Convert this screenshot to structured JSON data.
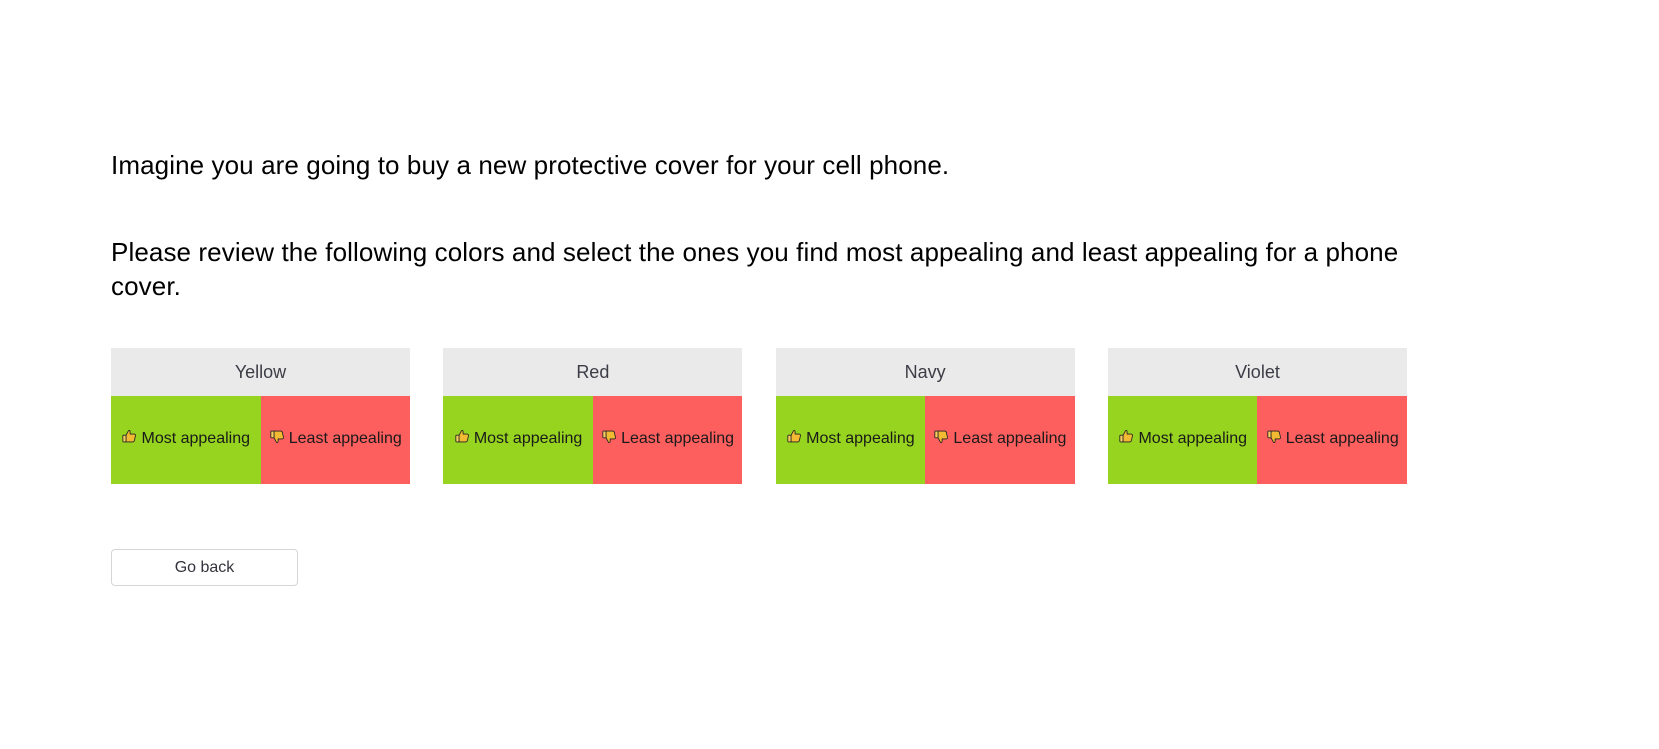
{
  "survey": {
    "intro_line": "Imagine you are going to buy a new protective cover for your cell phone.",
    "instruction_line": "Please review the following colors and select the ones you find most appealing and least appealing for a phone cover.",
    "cards": [
      {
        "color_name": "Yellow",
        "most_label": "Most appealing",
        "least_label": "Least appealing",
        "most_icon": "thumbs-up-icon",
        "least_icon": "thumbs-down-icon"
      },
      {
        "color_name": "Red",
        "most_label": "Most appealing",
        "least_label": "Least appealing",
        "most_icon": "thumbs-up-icon",
        "least_icon": "thumbs-down-icon"
      },
      {
        "color_name": "Navy",
        "most_label": "Most appealing",
        "least_label": "Least appealing",
        "most_icon": "thumbs-up-icon",
        "least_icon": "thumbs-down-icon"
      },
      {
        "color_name": "Violet",
        "most_label": "Most appealing",
        "least_label": "Least appealing",
        "most_icon": "thumbs-up-icon",
        "least_icon": "thumbs-down-icon"
      }
    ],
    "go_back_label": "Go back",
    "colors": {
      "most_appealing_background": "#96d420",
      "least_appealing_background": "#fd5f5f",
      "card_header_background": "#eaeaea",
      "page_background": "#ffffff",
      "text": "#000000",
      "button_border": "#d5d5d5"
    }
  }
}
